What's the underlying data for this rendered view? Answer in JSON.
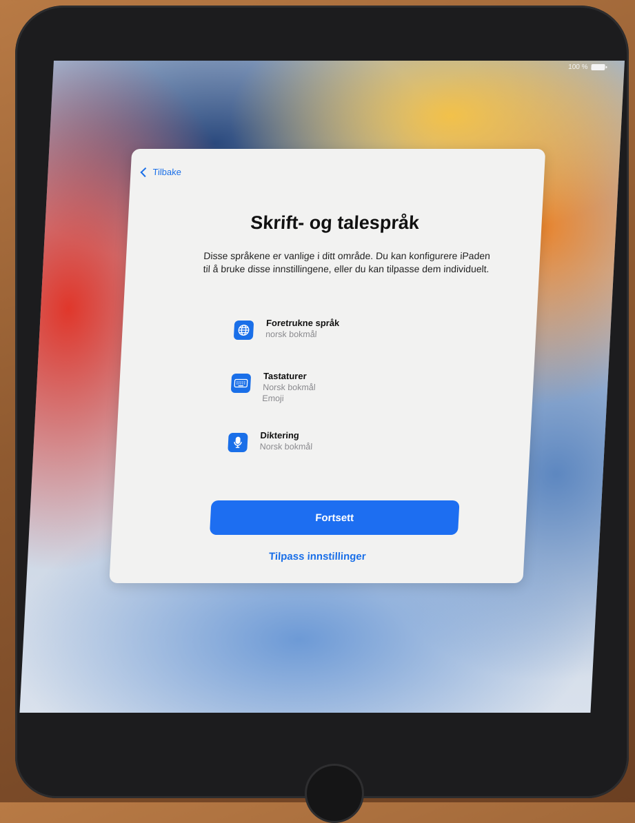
{
  "status_bar": {
    "battery": "100 %"
  },
  "sheet": {
    "back_label": "Tilbake",
    "title": "Skrift- og talespråk",
    "description": "Disse språkene er vanlige i ditt område. Du kan konfigurere iPaden til å bruke disse innstillingene, eller du kan tilpasse dem individuelt.",
    "options": [
      {
        "icon": "globe-icon",
        "title": "Foretrukne språk",
        "subtitles": [
          "norsk bokmål"
        ]
      },
      {
        "icon": "keyboard-icon",
        "title": "Tastaturer",
        "subtitles": [
          "Norsk bokmål",
          "Emoji"
        ]
      },
      {
        "icon": "microphone-icon",
        "title": "Diktering",
        "subtitles": [
          "Norsk bokmål"
        ]
      }
    ],
    "primary_button": "Fortsett",
    "secondary_link": "Tilpass innstillinger"
  },
  "colors": {
    "accent": "#1d6ef1",
    "sheet_bg": "#f2f2f1"
  }
}
